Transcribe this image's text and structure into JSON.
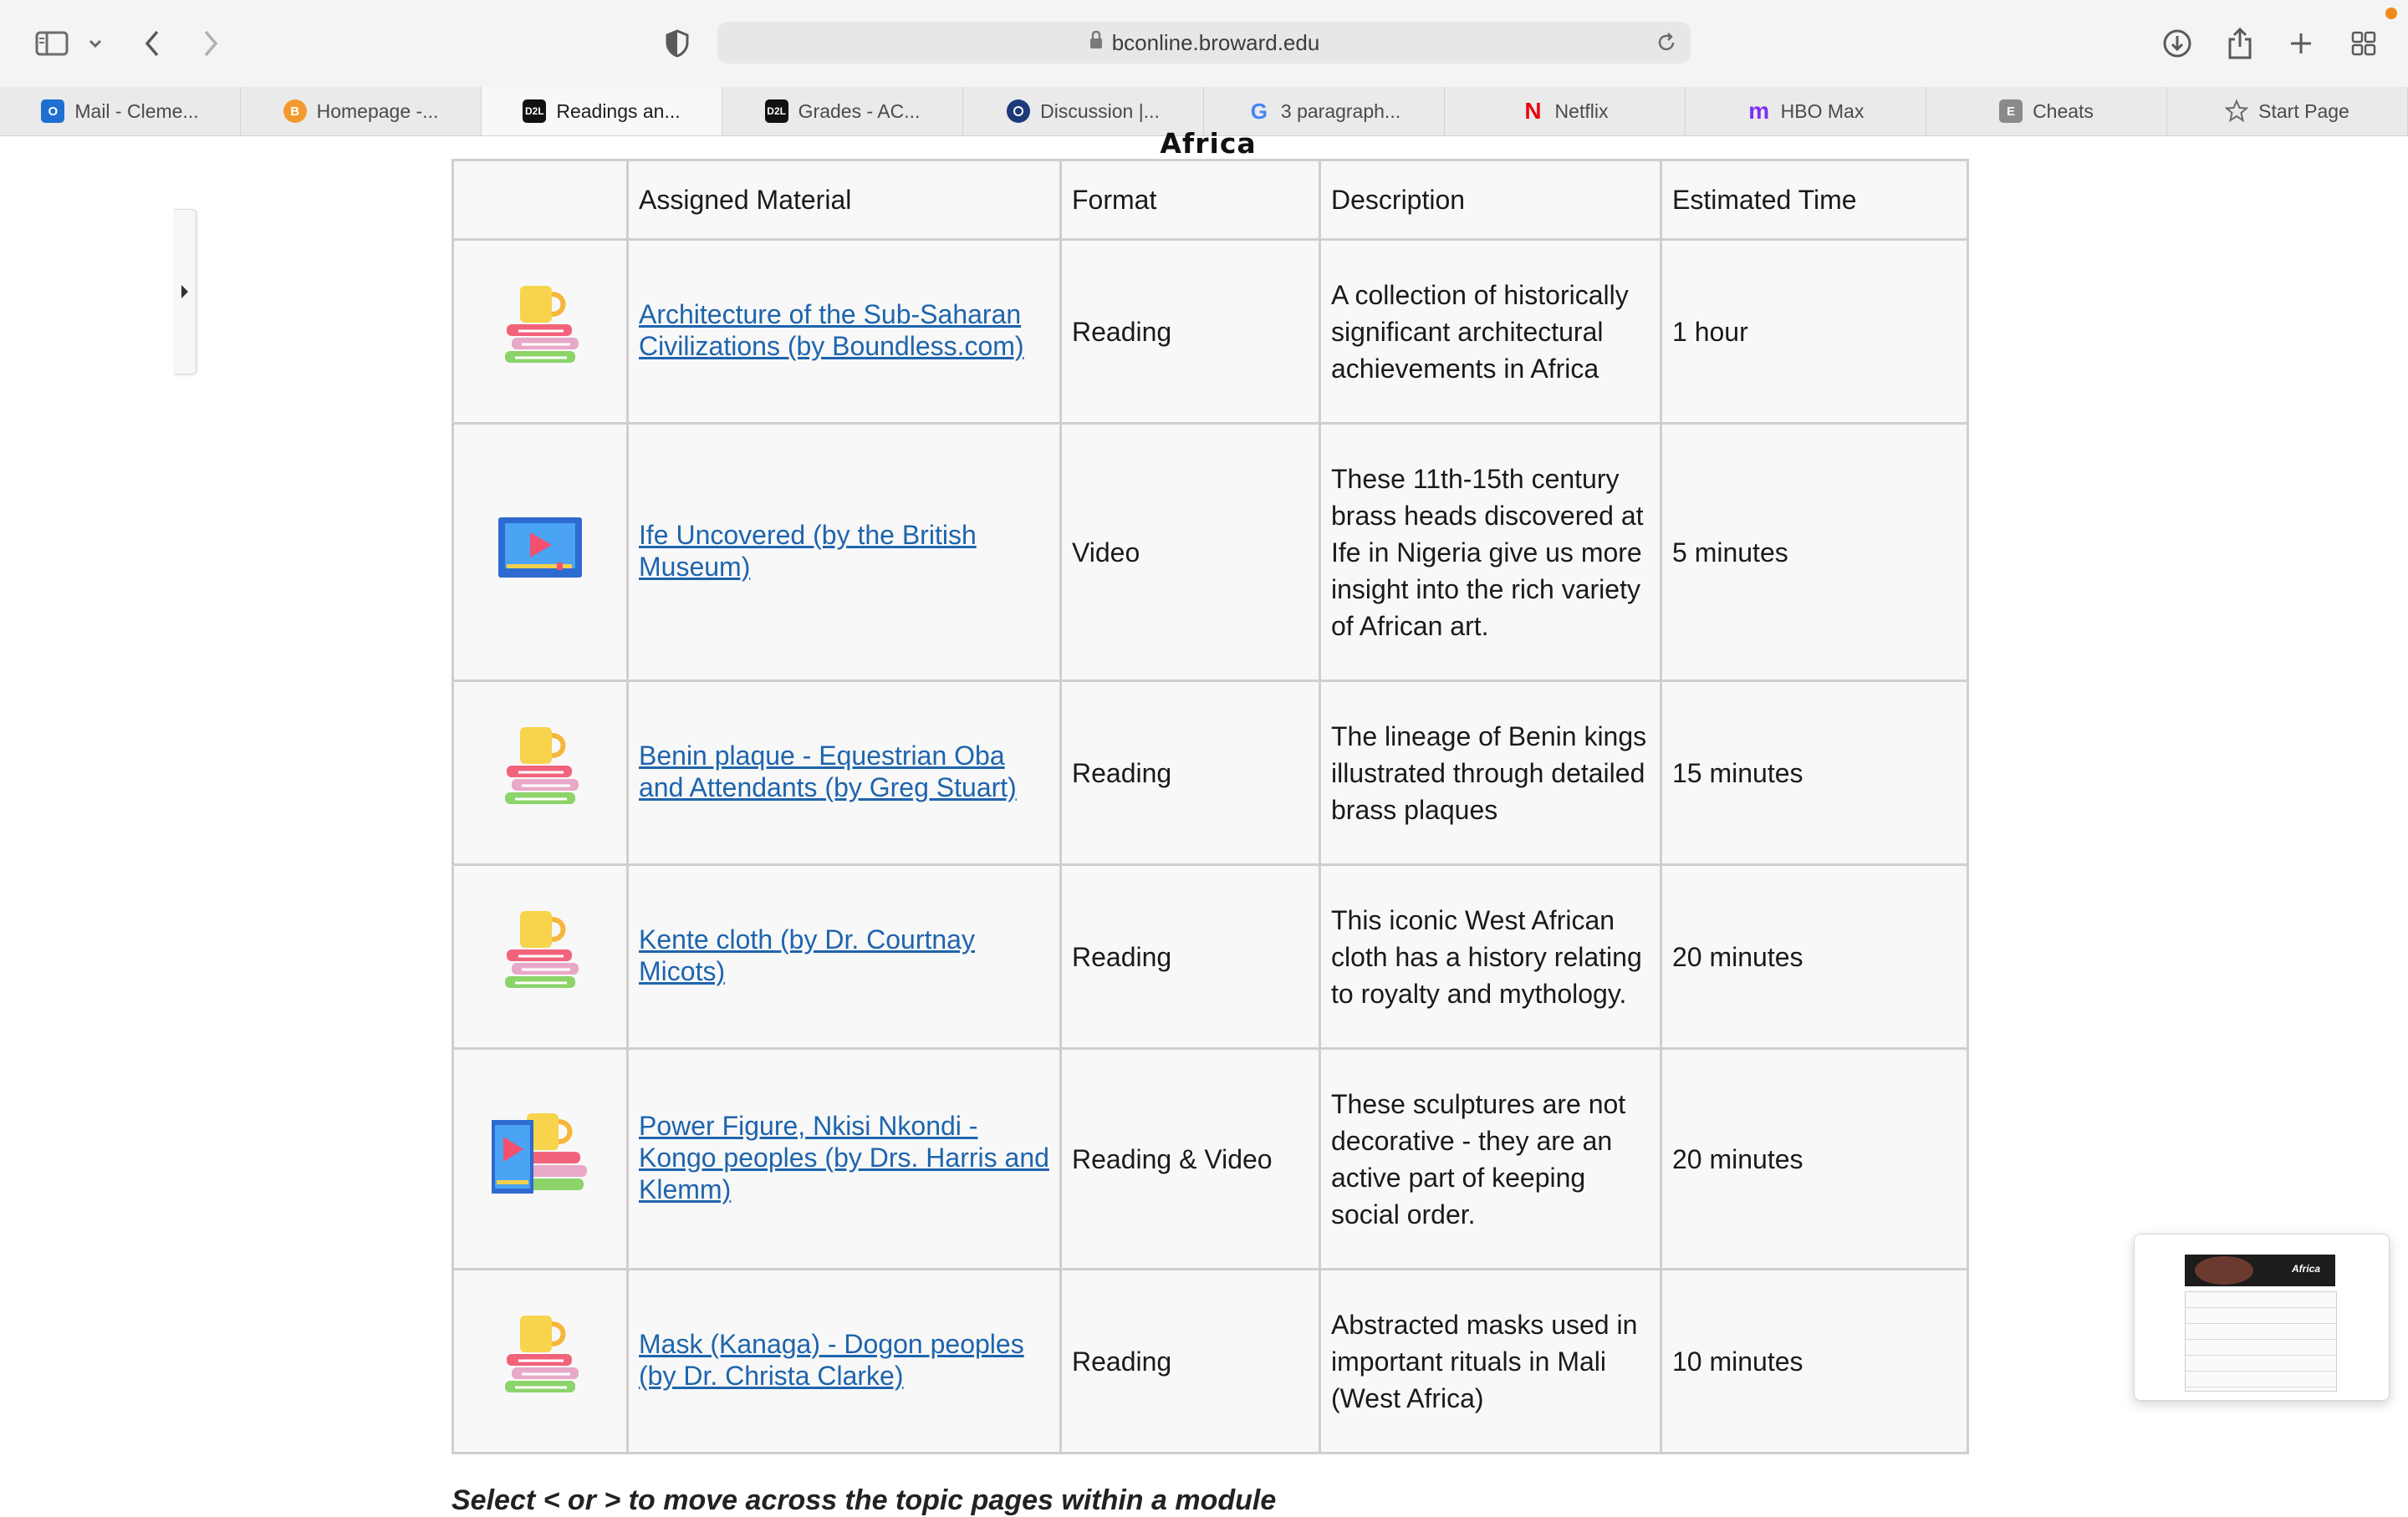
{
  "browser": {
    "url": "bconline.broward.edu",
    "tabs": [
      {
        "label": "Mail - Cleme...",
        "icon": "outlook-icon",
        "color": "#1f6fd1",
        "active": false
      },
      {
        "label": "Homepage -...",
        "icon": "bitcoin-icon",
        "color": "#f39a2e",
        "active": false
      },
      {
        "label": "Readings an...",
        "icon": "d2l-icon",
        "color": "#111111",
        "active": true
      },
      {
        "label": "Grades - AC...",
        "icon": "d2l-icon",
        "color": "#111111",
        "active": false
      },
      {
        "label": "Discussion |...",
        "icon": "discussion-icon",
        "color": "#1c3a7a",
        "active": false
      },
      {
        "label": "3 paragraph...",
        "icon": "google-icon",
        "color": "#4285f4",
        "active": false
      },
      {
        "label": "Netflix",
        "icon": "netflix-icon",
        "color": "#e50914",
        "active": false
      },
      {
        "label": "HBO Max",
        "icon": "hbomax-icon",
        "color": "#7b2ff7",
        "active": false
      },
      {
        "label": "Cheats",
        "icon": "cheats-icon",
        "color": "#8a8a8a",
        "active": false
      },
      {
        "label": "Start Page",
        "icon": "star-icon",
        "color": "#6b6b6b",
        "active": false
      }
    ]
  },
  "page": {
    "title": "Africa",
    "footer_hint": "Select < or > to move across the topic pages within a module",
    "headers": [
      "",
      "Assigned Material",
      "Format",
      "Description",
      "Estimated Time"
    ],
    "rows": [
      {
        "icon": "reading-icon",
        "material": "Architecture of the Sub-Saharan Civilizations (by Boundless.com)",
        "format": "Reading",
        "description": "A collection of historically significant architectural achievements in Africa",
        "time": "1 hour"
      },
      {
        "icon": "video-icon",
        "material": "Ife Uncovered (by the British Museum)",
        "format": "Video",
        "description": "These 11th-15th century brass heads discovered at Ife in Nigeria give us more insight into the rich variety of African art.",
        "time": "5 minutes"
      },
      {
        "icon": "reading-icon",
        "material": "Benin plaque - Equestrian Oba and Attendants (by Greg Stuart)",
        "format": "Reading",
        "description": "The lineage of Benin kings illustrated through detailed brass plaques",
        "time": "15 minutes"
      },
      {
        "icon": "reading-icon",
        "material": "Kente cloth (by Dr. Courtnay Micots)",
        "format": "Reading",
        "description": "This iconic West African cloth has a history relating to royalty and mythology.",
        "time": "20 minutes"
      },
      {
        "icon": "reading-video-icon",
        "material": "Power Figure, Nkisi Nkondi - Kongo peoples (by Drs. Harris and Klemm)",
        "format": "Reading & Video",
        "description": "These sculptures are not decorative - they are an active part of keeping social order.",
        "time": "20 minutes"
      },
      {
        "icon": "reading-icon",
        "material": "Mask (Kanaga) - Dogon peoples (by Dr. Christa Clarke)",
        "format": "Reading",
        "description": "Abstracted masks used in important rituals in Mali (West Africa)",
        "time": "10 minutes"
      }
    ],
    "thumbnail_title": "Africa"
  }
}
